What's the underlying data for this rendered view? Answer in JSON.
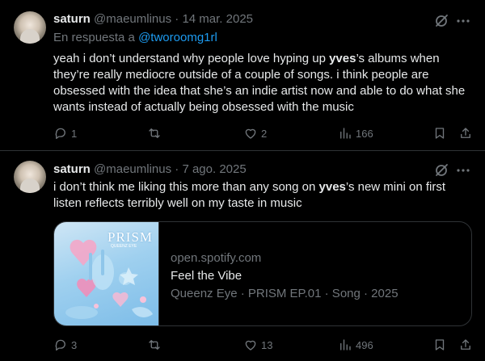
{
  "posts": [
    {
      "author_name": "saturn",
      "author_handle": "@maeumlinus",
      "separator": " · ",
      "date": "14 mar. 2025",
      "reply_prefix": "En respuesta a ",
      "reply_handle": "@tworoomg1rl",
      "text_before": "yeah i don’t understand why people love hyping up ",
      "text_bold": "yves",
      "text_after": "’s albums when they’re really mediocre outside of a couple of songs. i think people are obsessed with the idea that she’s an indie artist now and able to do what she wants instead of actually being obsessed with the music",
      "counts": {
        "replies": "1",
        "reposts": "",
        "likes": "2",
        "views": "166"
      }
    },
    {
      "author_name": "saturn",
      "author_handle": "@maeumlinus",
      "separator": " · ",
      "date": "7 ago. 2025",
      "text_before": "i don’t think me liking this more than any song on ",
      "text_bold": "yves",
      "text_after": "’s new mini on first listen reflects terribly well on my taste in music",
      "card": {
        "cover_title": "PRISM",
        "cover_subtitle": "QUEENZ EYE",
        "domain": "open.spotify.com",
        "title": "Feel the Vibe",
        "meta": "Queenz Eye · PRISM EP.01 · Song · 2025"
      },
      "counts": {
        "replies": "3",
        "reposts": "",
        "likes": "13",
        "views": "496"
      }
    }
  ],
  "icons": [
    "grok-icon",
    "more-icon",
    "reply-icon",
    "repost-icon",
    "like-icon",
    "views-icon",
    "bookmark-icon",
    "share-icon"
  ],
  "colors": {
    "background": "#000000",
    "text": "#e7e9ea",
    "muted": "#71767b",
    "link": "#1d9bf0",
    "border": "#2f3336"
  }
}
